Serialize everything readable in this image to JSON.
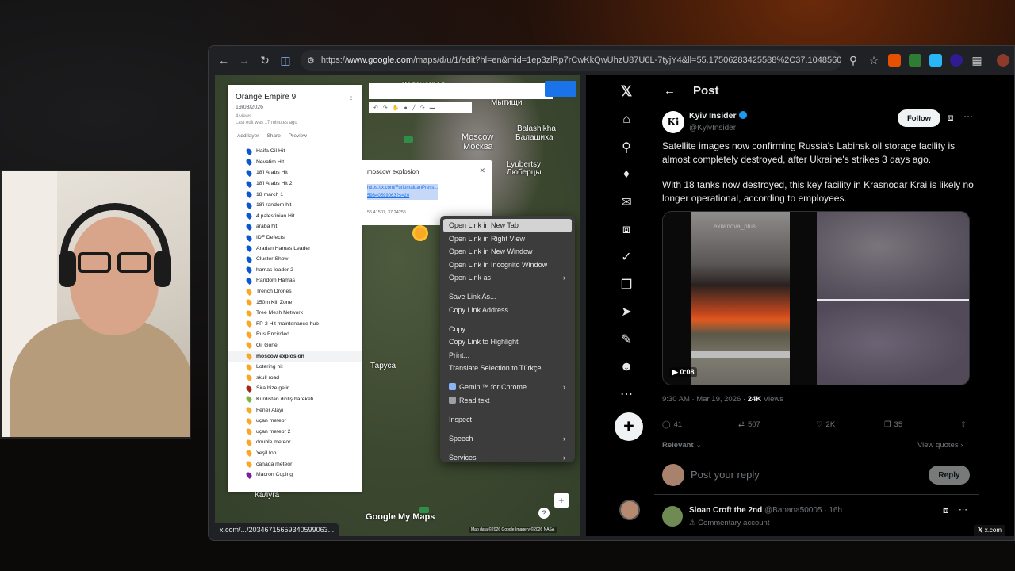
{
  "browser": {
    "url_prefix": "https://",
    "url_domain": "www.google.com",
    "url_rest": "/maps/d/u/1/edit?hl=en&mid=1ep3zlRp7rCwKkQwUhzU87U6L-7tyjY4&ll=55.17506283425588%2C37.104856007421...",
    "status_url": "x.com/.../20346715659340599063..."
  },
  "map": {
    "title": "Orange Empire 9",
    "date": "19/03/2026",
    "views": "4 views",
    "last_edit": "Last edit was 17 minutes ago",
    "actions": [
      "Add layer",
      "Share",
      "Preview"
    ],
    "items": [
      {
        "label": "Haifa Oil Hit",
        "color": "#0b57d0"
      },
      {
        "label": "Nevatim Hit",
        "color": "#0b57d0"
      },
      {
        "label": "18'i Arabs Hit",
        "color": "#0b57d0"
      },
      {
        "label": "18'i Arabs Hit 2",
        "color": "#0b57d0"
      },
      {
        "label": "18 march 1",
        "color": "#0b57d0"
      },
      {
        "label": "18'i random hit",
        "color": "#0b57d0"
      },
      {
        "label": "4 palestinian Hit",
        "color": "#0b57d0"
      },
      {
        "label": "araba hit",
        "color": "#0b57d0"
      },
      {
        "label": "IDF Defects",
        "color": "#0b57d0"
      },
      {
        "label": "Aradan Hamas Leader",
        "color": "#0b57d0"
      },
      {
        "label": "Cluster Show",
        "color": "#0b57d0"
      },
      {
        "label": "hamas leader 2",
        "color": "#0b57d0"
      },
      {
        "label": "Random Hamas",
        "color": "#0b57d0"
      },
      {
        "label": "Trench Drones",
        "color": "#f9a825"
      },
      {
        "label": "150m Kill Zone",
        "color": "#f9a825"
      },
      {
        "label": "Tree Mesh Network",
        "color": "#f9a825"
      },
      {
        "label": "FP-2 Hit maintenance hub",
        "color": "#f9a825"
      },
      {
        "label": "Rus Encircled",
        "color": "#f9a825"
      },
      {
        "label": "Oil Gone",
        "color": "#f9a825"
      },
      {
        "label": "moscow explosion",
        "color": "#f9a825"
      },
      {
        "label": "Lotering hit",
        "color": "#f9a825"
      },
      {
        "label": "skull road",
        "color": "#f9a825"
      },
      {
        "label": "Sira bize gelir",
        "color": "#a52714"
      },
      {
        "label": "Kürdistan diriliş hareketi",
        "color": "#7cb342"
      },
      {
        "label": "Fener Alayi",
        "color": "#f9a825"
      },
      {
        "label": "uçan meteor",
        "color": "#f9a825"
      },
      {
        "label": "uçan meteor 2",
        "color": "#f9a825"
      },
      {
        "label": "double meteor",
        "color": "#f9a825"
      },
      {
        "label": "Yeşil top",
        "color": "#f9a825"
      },
      {
        "label": "canada meteor",
        "color": "#f9a825"
      },
      {
        "label": "Macron Coping",
        "color": "#7b1fa2"
      }
    ],
    "selected": "moscow explosion",
    "place_labels": [
      {
        "text": "Москва",
        "big": true
      },
      {
        "text": "Moscow",
        "big": true
      },
      {
        "text": "Balashikha",
        "big": false
      },
      {
        "text": "Балашиха",
        "big": false
      },
      {
        "text": "Lyubertsy",
        "big": false
      },
      {
        "text": "Люберцы",
        "big": false
      },
      {
        "text": "Мытищи",
        "big": false
      },
      {
        "text": "Зеленоград",
        "big": false
      },
      {
        "text": "Калуга",
        "big": false
      },
      {
        "text": "Таруса",
        "big": false
      }
    ],
    "infowindow": {
      "title": "moscow explosion",
      "link_line1": "https://x.com/FuriomaidanPress...",
      "link_line2": "59340599063?s=20",
      "coords": "55.41507, 37.24255"
    },
    "logo": "Google My Maps",
    "footer": "Map data ©2026 Google Imagery ©2026 NASA"
  },
  "context_menu": [
    {
      "label": "Open Link in New Tab",
      "highlighted": true
    },
    {
      "label": "Open Link in Right View"
    },
    {
      "label": "Open Link in New Window"
    },
    {
      "label": "Open Link in Incognito Window"
    },
    {
      "label": "Open Link as",
      "submenu": true
    },
    {
      "sep": true
    },
    {
      "label": "Save Link As..."
    },
    {
      "label": "Copy Link Address"
    },
    {
      "sep": true
    },
    {
      "label": "Copy"
    },
    {
      "label": "Copy Link to Highlight"
    },
    {
      "label": "Print..."
    },
    {
      "label": "Translate Selection to Türkçe"
    },
    {
      "sep": true
    },
    {
      "label": "Gemini™ for Chrome",
      "submenu": true,
      "icon": "#8ab4f8"
    },
    {
      "label": "Read text",
      "icon": "#9aa0a6"
    },
    {
      "sep": true
    },
    {
      "label": "Inspect"
    },
    {
      "sep": true
    },
    {
      "label": "Speech",
      "submenu": true
    },
    {
      "sep": true
    },
    {
      "label": "Services",
      "submenu": true
    }
  ],
  "x": {
    "header_title": "Post",
    "author_name": "Kyiv Insider",
    "author_handle": "@KyivInsider",
    "avatar_text": "Ki",
    "follow_label": "Follow",
    "text_p1": "Satellite images now confirming Russia's Labinsk oil storage facility is almost completely destroyed, after Ukraine's strikes 3 days ago.",
    "text_p2": "With 18 tanks now destroyed, this key facility in Krasnodar Krai is likely no longer operational, according to employees.",
    "video_time": "0:08",
    "video_watermark": "exilenova_plus",
    "meta_time": "9:30 AM · Mar 19, 2026 · ",
    "meta_views": "24K",
    "meta_views_label": " Views",
    "stats": {
      "replies": "41",
      "reposts": "507",
      "likes": "2K",
      "bookmarks": "35"
    },
    "relevant": "Relevant",
    "view_quotes": "View quotes",
    "reply_placeholder": "Post your reply",
    "reply_button": "Reply",
    "comment": {
      "name": "Sloan Croft the 2nd",
      "handle": "@Banana50005 · 16h",
      "tag": "Commentary account"
    },
    "badge": "x.com"
  }
}
